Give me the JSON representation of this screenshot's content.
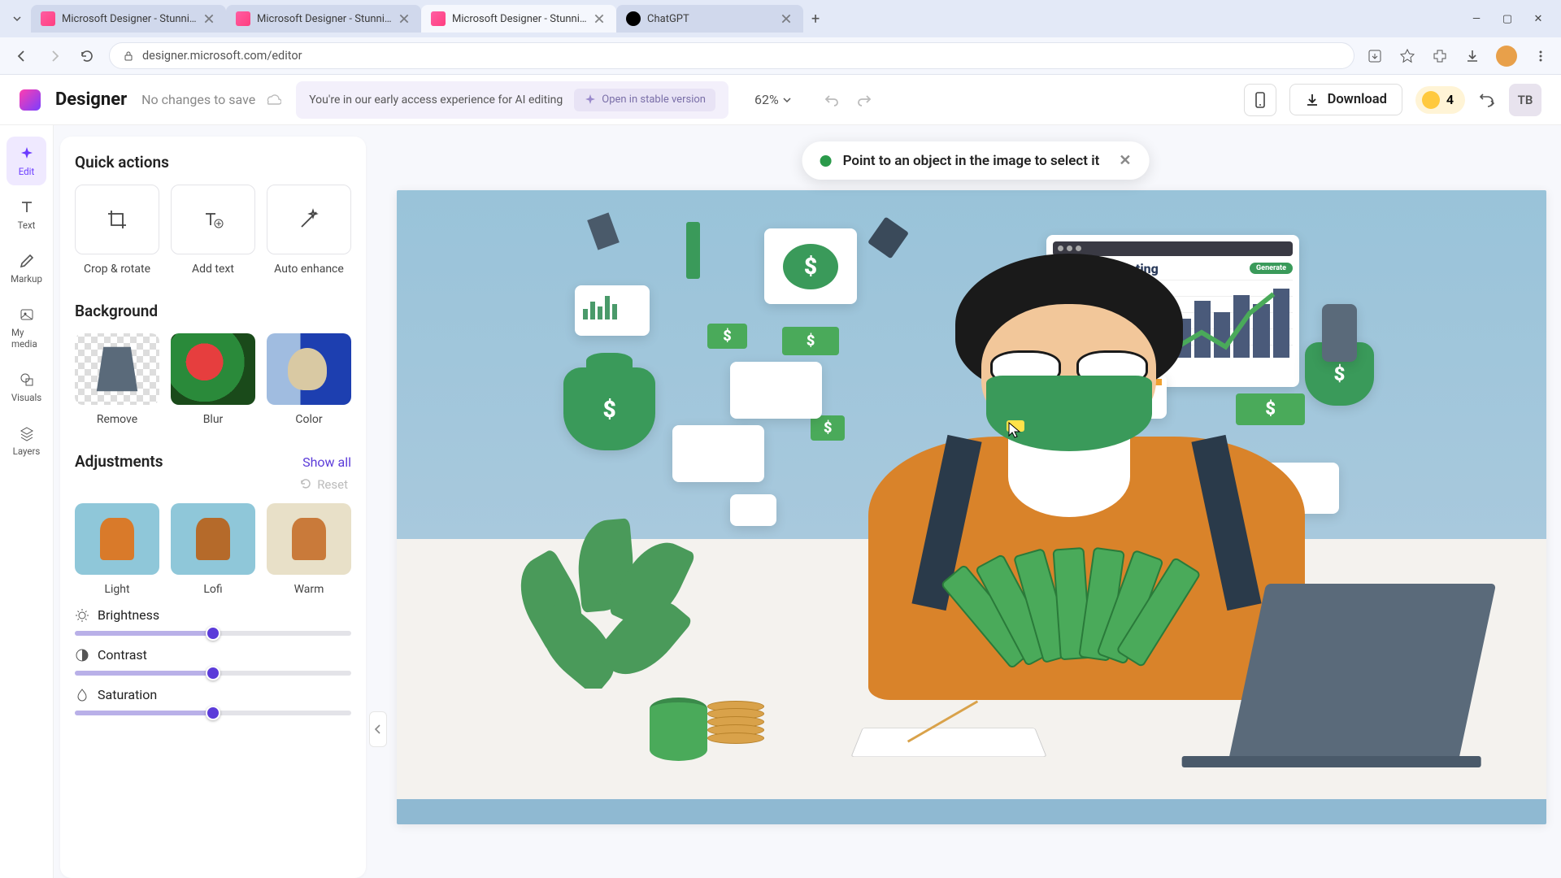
{
  "browser": {
    "tabs": [
      {
        "title": "Microsoft Designer - Stunning",
        "active": false,
        "favicon": "designer"
      },
      {
        "title": "Microsoft Designer - Stunning",
        "active": false,
        "favicon": "designer"
      },
      {
        "title": "Microsoft Designer - Stunning",
        "active": true,
        "favicon": "designer"
      },
      {
        "title": "ChatGPT",
        "active": false,
        "favicon": "chatgpt"
      }
    ],
    "url": "designer.microsoft.com/editor"
  },
  "header": {
    "app_name": "Designer",
    "save_state": "No changes to save",
    "early_text": "You're in our early access experience for AI editing",
    "stable_btn": "Open in stable version",
    "zoom": "62%",
    "download": "Download",
    "coins": "4",
    "user": "TB"
  },
  "rail": {
    "items": [
      {
        "label": "Edit",
        "icon": "sparkle"
      },
      {
        "label": "Text",
        "icon": "text"
      },
      {
        "label": "Markup",
        "icon": "pencil"
      },
      {
        "label": "My media",
        "icon": "image"
      },
      {
        "label": "Visuals",
        "icon": "overlap"
      },
      {
        "label": "Layers",
        "icon": "layers"
      }
    ]
  },
  "panel": {
    "quick_title": "Quick actions",
    "quick": [
      {
        "label": "Crop & rotate"
      },
      {
        "label": "Add text"
      },
      {
        "label": "Auto enhance"
      }
    ],
    "bg_title": "Background",
    "bg": [
      {
        "label": "Remove"
      },
      {
        "label": "Blur"
      },
      {
        "label": "Color"
      }
    ],
    "adj_title": "Adjustments",
    "show_all": "Show all",
    "reset": "Reset",
    "presets": [
      {
        "label": "Light"
      },
      {
        "label": "Lofi"
      },
      {
        "label": "Warm"
      }
    ],
    "sliders": [
      {
        "name": "Brightness",
        "value": "0"
      },
      {
        "name": "Contrast",
        "value": "0"
      },
      {
        "name": "Saturation",
        "value": "0"
      }
    ]
  },
  "toast": {
    "text": "Point to an object in the image to select it"
  },
  "canvas": {
    "investing_title": "Divonnt Investing",
    "investing_btn": "Generate"
  }
}
